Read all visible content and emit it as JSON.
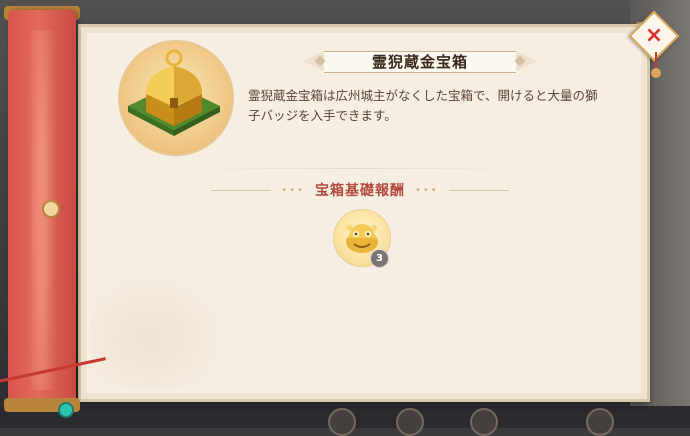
{
  "dialog": {
    "title": "霊猊蔵金宝箱",
    "description": "霊猊蔵金宝箱は広州城主がなくした宝箱で、開けると大量の獅子バッジを入手できます。",
    "close_icon": "×"
  },
  "reward_section": {
    "heading": "宝箱基礎報酬",
    "items": [
      {
        "name": "獅子バッジ",
        "icon": "lion-badge-icon",
        "count": "3"
      }
    ]
  },
  "colors": {
    "accent_red": "#b24b3e",
    "scroll_red": "#d8554b",
    "paper": "#f6eee2",
    "gold": "#f1cd7e"
  }
}
